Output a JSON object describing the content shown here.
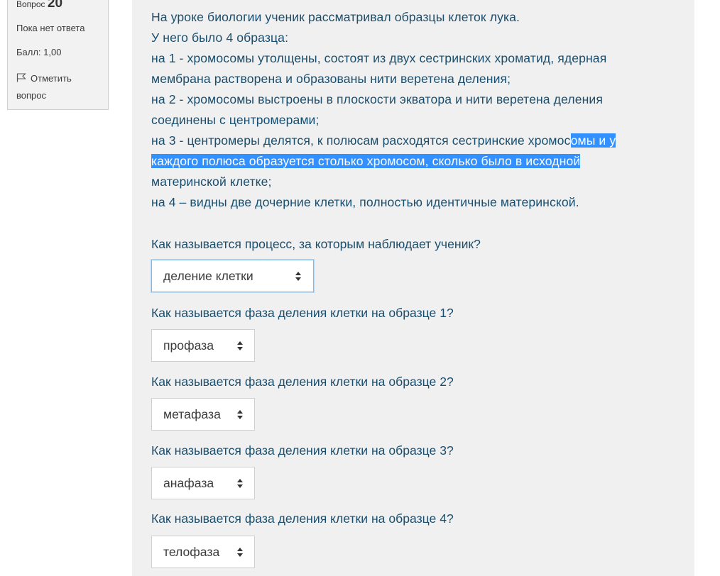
{
  "info": {
    "question_label": "Вопрос",
    "question_number": "20",
    "state": "Пока нет ответа",
    "grade": "Балл: 1,00",
    "flag_label": "Отметить вопрос"
  },
  "question": {
    "lines": [
      "На уроке биологии ученик рассматривал образцы клеток лука.",
      "У него было 4 образца:",
      "на 1 - хромосомы утолщены, состоят из двух сестринских хроматид, ядерная",
      "мембрана растворена и образованы нити веретена деления;",
      "на 2 - хромосомы выстроены в плоскости экватора и нити веретена деления",
      "соединены с центромерами;"
    ],
    "line7_plain": "на 3 - центромеры делятся, к полюсам расходятся сестринские хромос",
    "line7_selected": "омы и у",
    "line8_selected": "каждого полюса образуется столько хромосом, сколько было в исходной",
    "line9": "материнской клетке;",
    "line10": "на 4 – видны две дочерние клетки, полностью идентичные материнской."
  },
  "subquestions": [
    {
      "text": "Как называется процесс, за которым наблюдает ученик?",
      "selected": "деление клетки"
    },
    {
      "text": "Как называется фаза деления клетки на образце 1?",
      "selected": "профаза"
    },
    {
      "text": "Как называется фаза деления клетки на образце 2?",
      "selected": "метафаза"
    },
    {
      "text": "Как называется фаза деления клетки на образце 3?",
      "selected": "анафаза"
    },
    {
      "text": "Как называется фаза деления клетки на образце 4?",
      "selected": "телофаза"
    }
  ],
  "icons": {
    "flag": "flag-icon",
    "select_arrows": "select-arrows-icon"
  },
  "colors": {
    "text": "#1a4e6e",
    "selection": "#3390ff",
    "panel_bg": "#f2f2f2",
    "content_bg": "#f0f0f0",
    "focus_border": "#7fb8e8"
  }
}
